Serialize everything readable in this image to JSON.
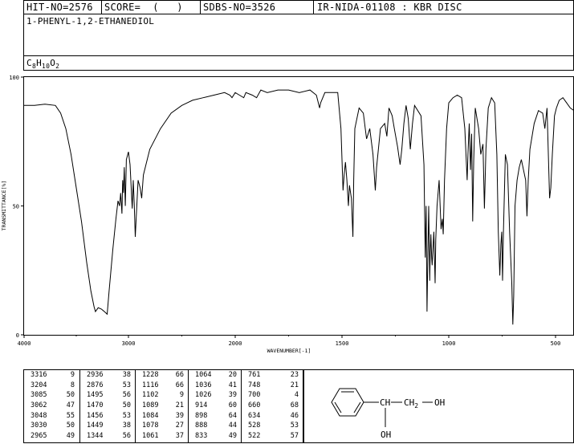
{
  "header": {
    "hit_no": "HIT-NO=2576",
    "score": "SCORE=  (   )",
    "sdbs_no": "SDBS-NO=3526",
    "ir_info": "IR-NIDA-01108 : KBR DISC",
    "compound_name": "1-PHENYL-1,2-ETHANEDIOL",
    "formula": {
      "c": "C",
      "c_sub": "8",
      "h": "H",
      "h_sub": "10",
      "o": "O",
      "o_sub": "2"
    }
  },
  "chart_data": {
    "type": "line",
    "xlabel": "WAVENUMBER[-1]",
    "ylabel": "TRANSMITTANCE[%]",
    "xlim": [
      4000,
      400
    ],
    "ylim": [
      0,
      100
    ],
    "x_ticks": [
      "4000",
      "3000",
      "2000",
      "1500",
      "1000",
      "500"
    ],
    "y_ticks": [
      "0",
      "50",
      "100"
    ],
    "x_tick_values": [
      4000,
      3000,
      2000,
      1500,
      1000,
      500
    ],
    "y_tick_values": [
      0,
      50,
      100
    ],
    "spectrum": [
      [
        4000,
        89
      ],
      [
        3900,
        89
      ],
      [
        3800,
        89.5
      ],
      [
        3700,
        89
      ],
      [
        3650,
        86
      ],
      [
        3600,
        80
      ],
      [
        3550,
        70
      ],
      [
        3500,
        57
      ],
      [
        3450,
        44
      ],
      [
        3400,
        28
      ],
      [
        3360,
        17
      ],
      [
        3330,
        11
      ],
      [
        3316,
        9
      ],
      [
        3290,
        10.5
      ],
      [
        3260,
        10
      ],
      [
        3230,
        9
      ],
      [
        3204,
        8
      ],
      [
        3185,
        17
      ],
      [
        3150,
        33
      ],
      [
        3120,
        45
      ],
      [
        3100,
        52
      ],
      [
        3085,
        50
      ],
      [
        3075,
        55
      ],
      [
        3062,
        47
      ],
      [
        3055,
        60
      ],
      [
        3048,
        55
      ],
      [
        3040,
        65
      ],
      [
        3030,
        50
      ],
      [
        3020,
        68
      ],
      [
        3000,
        71
      ],
      [
        2985,
        66
      ],
      [
        2965,
        49
      ],
      [
        2955,
        60
      ],
      [
        2945,
        50
      ],
      [
        2936,
        38
      ],
      [
        2928,
        45
      ],
      [
        2910,
        60
      ],
      [
        2890,
        57
      ],
      [
        2876,
        53
      ],
      [
        2860,
        62
      ],
      [
        2830,
        67
      ],
      [
        2800,
        72
      ],
      [
        2700,
        80
      ],
      [
        2600,
        86
      ],
      [
        2500,
        89
      ],
      [
        2400,
        91
      ],
      [
        2300,
        92
      ],
      [
        2200,
        93
      ],
      [
        2100,
        94
      ],
      [
        2050,
        93
      ],
      [
        2030,
        92
      ],
      [
        2000,
        94
      ],
      [
        1980,
        93
      ],
      [
        1960,
        92
      ],
      [
        1950,
        94
      ],
      [
        1920,
        93
      ],
      [
        1900,
        92
      ],
      [
        1880,
        95
      ],
      [
        1850,
        94
      ],
      [
        1800,
        95
      ],
      [
        1750,
        95
      ],
      [
        1700,
        94
      ],
      [
        1650,
        95
      ],
      [
        1620,
        93
      ],
      [
        1605,
        88
      ],
      [
        1600,
        90
      ],
      [
        1580,
        94
      ],
      [
        1550,
        94
      ],
      [
        1520,
        94
      ],
      [
        1505,
        80
      ],
      [
        1495,
        56
      ],
      [
        1490,
        62
      ],
      [
        1484,
        67
      ],
      [
        1477,
        60
      ],
      [
        1470,
        50
      ],
      [
        1465,
        58
      ],
      [
        1456,
        53
      ],
      [
        1449,
        38
      ],
      [
        1445,
        60
      ],
      [
        1440,
        80
      ],
      [
        1420,
        88
      ],
      [
        1400,
        86
      ],
      [
        1385,
        76
      ],
      [
        1370,
        80
      ],
      [
        1355,
        70
      ],
      [
        1344,
        56
      ],
      [
        1338,
        65
      ],
      [
        1320,
        80
      ],
      [
        1300,
        82
      ],
      [
        1290,
        77
      ],
      [
        1280,
        88
      ],
      [
        1265,
        85
      ],
      [
        1255,
        80
      ],
      [
        1240,
        73
      ],
      [
        1228,
        66
      ],
      [
        1220,
        72
      ],
      [
        1210,
        82
      ],
      [
        1200,
        89
      ],
      [
        1190,
        84
      ],
      [
        1180,
        72
      ],
      [
        1170,
        82
      ],
      [
        1160,
        89
      ],
      [
        1130,
        85
      ],
      [
        1116,
        66
      ],
      [
        1110,
        30
      ],
      [
        1106,
        50
      ],
      [
        1102,
        9
      ],
      [
        1098,
        30
      ],
      [
        1094,
        50
      ],
      [
        1089,
        21
      ],
      [
        1087,
        32
      ],
      [
        1084,
        39
      ],
      [
        1080,
        30
      ],
      [
        1078,
        27
      ],
      [
        1070,
        40
      ],
      [
        1064,
        20
      ],
      [
        1061,
        37
      ],
      [
        1055,
        50
      ],
      [
        1045,
        60
      ],
      [
        1036,
        41
      ],
      [
        1030,
        45
      ],
      [
        1026,
        39
      ],
      [
        1020,
        60
      ],
      [
        1010,
        80
      ],
      [
        1000,
        90
      ],
      [
        980,
        92
      ],
      [
        960,
        93
      ],
      [
        940,
        92
      ],
      [
        925,
        80
      ],
      [
        914,
        60
      ],
      [
        910,
        70
      ],
      [
        904,
        82
      ],
      [
        898,
        64
      ],
      [
        893,
        78
      ],
      [
        888,
        44
      ],
      [
        883,
        68
      ],
      [
        876,
        88
      ],
      [
        860,
        80
      ],
      [
        850,
        70
      ],
      [
        840,
        74
      ],
      [
        833,
        49
      ],
      [
        826,
        72
      ],
      [
        815,
        88
      ],
      [
        800,
        92
      ],
      [
        785,
        90
      ],
      [
        775,
        70
      ],
      [
        768,
        40
      ],
      [
        761,
        23
      ],
      [
        756,
        35
      ],
      [
        752,
        40
      ],
      [
        748,
        21
      ],
      [
        744,
        40
      ],
      [
        735,
        70
      ],
      [
        725,
        66
      ],
      [
        715,
        40
      ],
      [
        705,
        20
      ],
      [
        700,
        4
      ],
      [
        696,
        15
      ],
      [
        690,
        50
      ],
      [
        680,
        60
      ],
      [
        670,
        65
      ],
      [
        660,
        68
      ],
      [
        650,
        64
      ],
      [
        640,
        60
      ],
      [
        634,
        46
      ],
      [
        628,
        60
      ],
      [
        620,
        72
      ],
      [
        600,
        82
      ],
      [
        580,
        87
      ],
      [
        560,
        86
      ],
      [
        550,
        80
      ],
      [
        540,
        88
      ],
      [
        528,
        53
      ],
      [
        522,
        57
      ],
      [
        515,
        70
      ],
      [
        505,
        85
      ],
      [
        495,
        88
      ],
      [
        480,
        91
      ],
      [
        460,
        92
      ],
      [
        440,
        90
      ],
      [
        420,
        88
      ],
      [
        400,
        87
      ]
    ]
  },
  "peak_table": [
    [
      [
        "3316",
        "9"
      ],
      [
        "3204",
        "8"
      ],
      [
        "3085",
        "50"
      ],
      [
        "3062",
        "47"
      ],
      [
        "3048",
        "55"
      ],
      [
        "3030",
        "50"
      ],
      [
        "2965",
        "49"
      ]
    ],
    [
      [
        "2936",
        "38"
      ],
      [
        "2876",
        "53"
      ],
      [
        "1495",
        "56"
      ],
      [
        "1470",
        "50"
      ],
      [
        "1456",
        "53"
      ],
      [
        "1449",
        "38"
      ],
      [
        "1344",
        "56"
      ]
    ],
    [
      [
        "1228",
        "66"
      ],
      [
        "1116",
        "66"
      ],
      [
        "1102",
        "9"
      ],
      [
        "1089",
        "21"
      ],
      [
        "1084",
        "39"
      ],
      [
        "1078",
        "27"
      ],
      [
        "1061",
        "37"
      ]
    ],
    [
      [
        "1064",
        "20"
      ],
      [
        "1036",
        "41"
      ],
      [
        "1026",
        "39"
      ],
      [
        "914",
        "60"
      ],
      [
        "898",
        "64"
      ],
      [
        "888",
        "44"
      ],
      [
        "833",
        "49"
      ]
    ],
    [
      [
        "761",
        "23"
      ],
      [
        "748",
        "21"
      ],
      [
        "700",
        "4"
      ],
      [
        "660",
        "68"
      ],
      [
        "634",
        "46"
      ],
      [
        "528",
        "53"
      ],
      [
        "522",
        "57"
      ]
    ]
  ],
  "structure": {
    "ch": "CH",
    "ch2_main": "CH",
    "ch2_sub": "2",
    "oh_end": "OH",
    "oh_sub": "OH"
  }
}
